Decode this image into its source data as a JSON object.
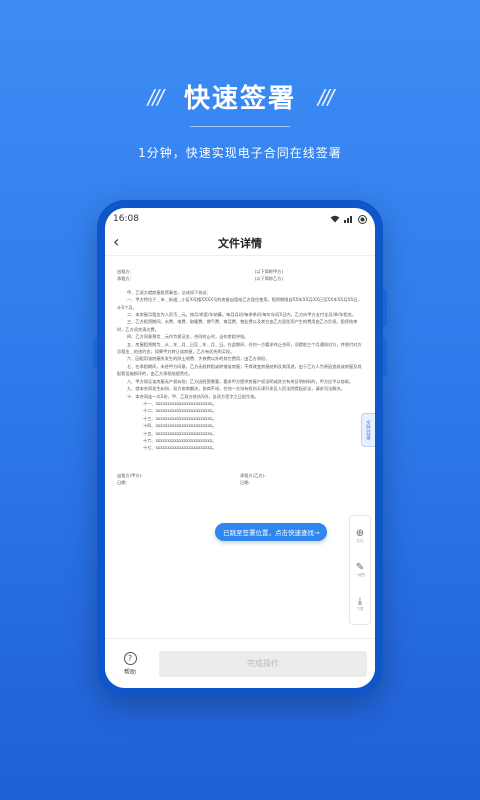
{
  "promo": {
    "slashes_left": "///",
    "slashes_right": "///",
    "title": "快速签署",
    "subtitle": "1分钟，快速实现电子合同在线签署"
  },
  "status_bar": {
    "time": "16:08",
    "icons": [
      "wifi-icon",
      "signal-icon",
      "battery-icon"
    ]
  },
  "nav": {
    "back_icon": "chevron-left-icon",
    "title": "文件详情"
  },
  "document": {
    "party_a_label": "出租方：",
    "party_a_value": "(以下简称甲方)",
    "party_b_label": "承租方：",
    "party_b_value": "(以下简称乙方)",
    "paragraphs": [
      "甲、乙双方就房屋租赁事宜，达成如下协议：",
      "一、甲方将位于＿市＿街道＿小区X号楼XXXX号的房屋出租给乙方居住使用，租赁期限自XX年XX月XX日至XX年XX月XX日，计X个月。",
      "二、本房屋月租金为人民币＿元，按月/季度/年结算。每月月初/每季季初/每年年初X日内，乙方向甲方支付全月/季/年租金。",
      "三、乙方租赁期间，水费、电费、取暖费、燃气费、电话费、物业费以及其它由乙方居住而产生的费用由乙方负担。租赁结束时，乙方须交清欠费。",
      "四、乙方同意预交＿元作为保证金，合同终止时，当作房租冲抵。",
      "五、房屋租赁期为＿从＿年＿月＿日至＿年＿月＿日。在此期间，任何一方要求终止合同，须提前三个月通知对方，并偿付对方总租金＿的违约金；如果甲方转让该房屋，乙方有优先购买权。",
      "六、因租用该房屋所发生的除土地费、大修费以外的其它费用，由乙方承担。",
      "七、在承租期间，未经甲方同意，乙方无权转租或转借该房屋；不得改变房屋结构及其用途，由于乙方人为原因造成该房屋及其配套设施损坏的，由乙方承担赔偿责任。",
      "八、甲方保证该房屋无产权纠纷；乙方因经营需要，要求甲方提供房屋产权证明或其它有关证明材料的，甲方应予以协助。",
      "九、就本合同发生纠纷，双方协商解决，协商不成，任何一方均有权向天津开发区人民法院提起诉讼，请求司法解决。",
      "十、本合同连一式X份，甲、乙双方各执X份，自双方签字之日起生效。"
    ],
    "list_items": [
      "十一、xxxxxxxxxxxxxxxxxxxxxxxx。",
      "十二、xxxxxxxxxxxxxxxxxxxxxxxx。",
      "十三、xxxxxxxxxxxxxxxxxxxxxxxx。",
      "十四、xxxxxxxxxxxxxxxxxxxxxxxx。",
      "十五、xxxxxxxxxxxxxxxxxxxxxxxx。",
      "十六、xxxxxxxxxxxxxxxxxxxxxxxx。",
      "十七、xxxxxxxxxxxxxxxxxxxxxxxx。"
    ],
    "sign_a_label": "出租方(甲方):",
    "sign_a_date": "日期:",
    "sign_b_label": "承租方(乙方):",
    "sign_b_date": "日期:"
  },
  "hint": {
    "text": "已跳至签署位置，点击快速查找→"
  },
  "side_tab": {
    "label": "文件目录"
  },
  "toolbar": {
    "items": [
      {
        "icon": "locate-icon",
        "label": "定位"
      },
      {
        "icon": "stamp-icon",
        "label": "一键签"
      },
      {
        "icon": "download-icon",
        "label": "下载"
      }
    ]
  },
  "bottom": {
    "help_icon": "question-icon",
    "help_label": "帮助",
    "complete_label": "完成操作"
  }
}
